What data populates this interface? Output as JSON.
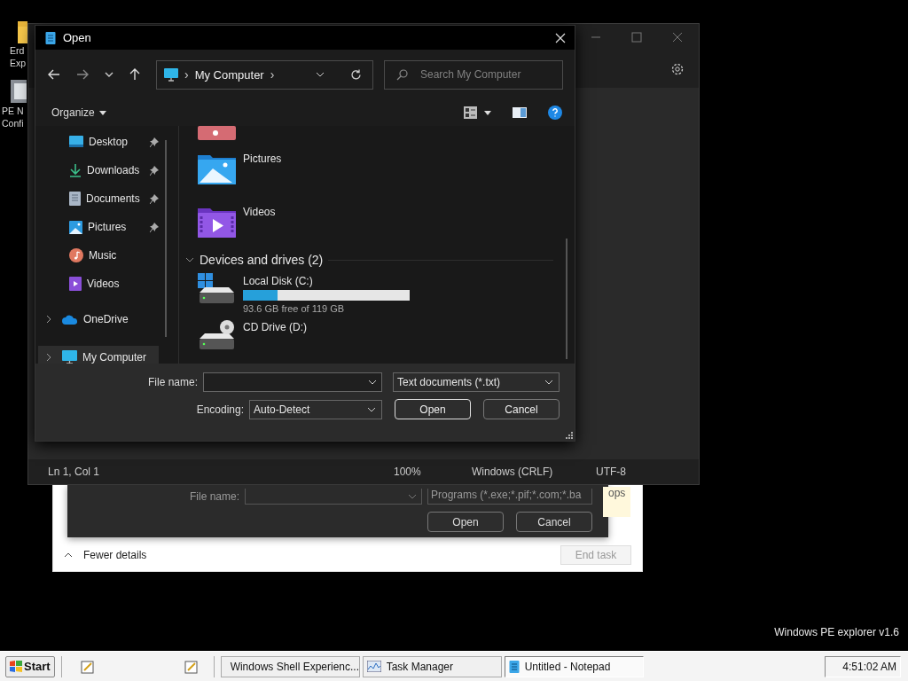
{
  "desktop": {
    "icons": [
      {
        "lines": [
          "Erd",
          "Exp"
        ]
      },
      {
        "lines": [
          "PE N",
          "Confi"
        ]
      }
    ],
    "version_label": "Windows PE explorer v1.6"
  },
  "task_manager": {
    "fewer_details": "Fewer details",
    "end_task": {
      "label": "End task",
      "disabled": true
    },
    "column_text": "ops",
    "run_dialog": {
      "file_name_label": "File name:",
      "filter": "Programs (*.exe;*.pif;*.com;*.ba",
      "buttons": [
        "Open",
        "Cancel"
      ]
    }
  },
  "notepad": {
    "status_bar": [
      "Ln 1, Col 1",
      "100%",
      "Windows (CRLF)",
      "UTF-8"
    ]
  },
  "open_dialog": {
    "title": "Open",
    "address": {
      "before": "›",
      "text": "My Computer",
      "after": "›"
    },
    "search": {
      "placeholder": "Search My Computer"
    },
    "organize": "Organize",
    "sidebar": {
      "items": [
        {
          "label": "Desktop",
          "pinned": true,
          "expandable": false,
          "selected": false
        },
        {
          "label": "Downloads",
          "pinned": true,
          "expandable": false,
          "selected": false
        },
        {
          "label": "Documents",
          "pinned": true,
          "expandable": false,
          "selected": false
        },
        {
          "label": "Pictures",
          "pinned": true,
          "expandable": false,
          "selected": false
        },
        {
          "label": "Music",
          "pinned": false,
          "expandable": false,
          "selected": false
        },
        {
          "label": "Videos",
          "pinned": false,
          "expandable": false,
          "selected": false
        },
        {
          "label": "OneDrive",
          "pinned": false,
          "expandable": true,
          "selected": false
        },
        {
          "label": "My Computer",
          "pinned": false,
          "expandable": true,
          "selected": true
        }
      ]
    },
    "folders": [
      {
        "label": "Pictures"
      },
      {
        "label": "Videos"
      }
    ],
    "group": {
      "label": "Devices and drives (2)",
      "expanded": true
    },
    "drives": [
      {
        "name": "Local Disk (C:)",
        "kind": "disk",
        "level": 0.21,
        "free": "93.6 GB free of 119 GB"
      },
      {
        "name": "CD Drive (D:)",
        "kind": "cd"
      }
    ],
    "file_name_label": "File name:",
    "filter": "Text documents (*.txt)",
    "encoding_label": "Encoding:",
    "encoding": "Auto-Detect",
    "buttons": [
      {
        "label": "Open",
        "default": true
      },
      {
        "label": "Cancel",
        "default": false
      }
    ]
  },
  "taskbar": {
    "start": "Start",
    "tasks": [
      {
        "label": "Windows Shell Experienc...",
        "selected": false
      },
      {
        "label": "Task Manager",
        "selected": false
      },
      {
        "label": "Untitled - Notepad",
        "selected": true
      }
    ],
    "clock": "4:51:02 AM"
  }
}
